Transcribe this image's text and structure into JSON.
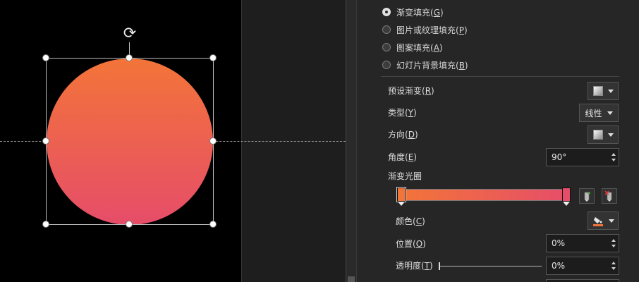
{
  "fill_options": [
    {
      "label": "渐变填充(",
      "key": "G",
      "checked": true
    },
    {
      "label": "图片或纹理填充(",
      "key": "P",
      "checked": false
    },
    {
      "label": "图案填充(",
      "key": "A",
      "checked": false
    },
    {
      "label": "幻灯片背景填充(",
      "key": "B",
      "checked": false
    }
  ],
  "preset_gradient": {
    "label": "预设渐变(",
    "key": "R"
  },
  "type": {
    "label": "类型(",
    "key": "Y",
    "value": "线性"
  },
  "direction": {
    "label": "方向(",
    "key": "D"
  },
  "angle": {
    "label": "角度(",
    "key": "E",
    "value": "90°"
  },
  "gradient_stops": {
    "label": "渐变光圈",
    "stops": [
      {
        "position": 0,
        "color": "#f37439",
        "selected": true
      },
      {
        "position": 100,
        "color": "#e64d69",
        "selected": false
      }
    ]
  },
  "color": {
    "label": "颜色(",
    "key": "C"
  },
  "position": {
    "label": "位置(",
    "key": "O",
    "value": "0%"
  },
  "transparency": {
    "label": "透明度(",
    "key": "T",
    "value": "0%"
  },
  "shape": {
    "gradient_start": "#f37439",
    "gradient_end": "#e64d69"
  },
  "icons": {
    "rotate": "rotate-handle-icon",
    "add_stop": "add-gradient-stop-icon",
    "remove_stop": "remove-gradient-stop-icon",
    "paint_bucket": "paint-bucket-icon"
  }
}
